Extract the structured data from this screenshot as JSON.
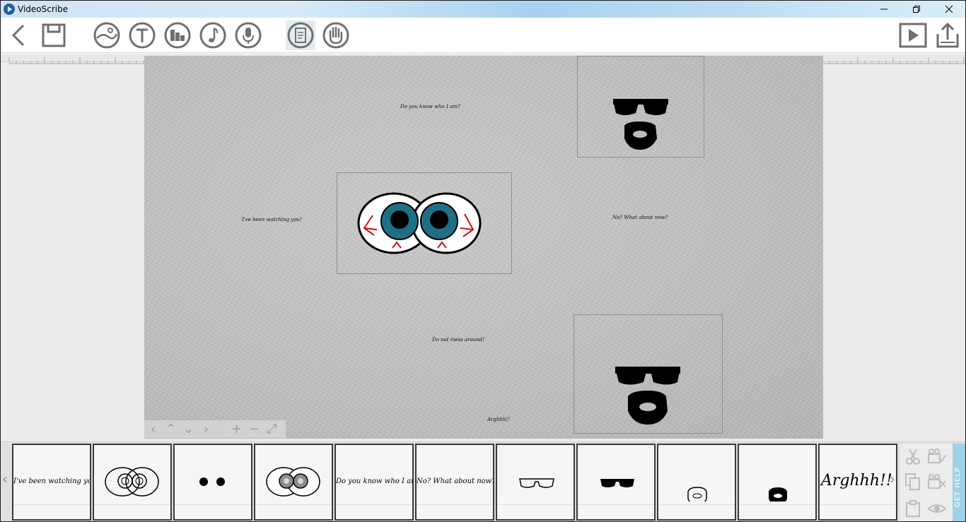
{
  "window": {
    "title": "VideoScribe"
  },
  "canvas_texts": {
    "know": "Do you know who I am?",
    "watching": "I've been watching you!",
    "what_about": "No? What about now?",
    "mess": "Do not mess around!",
    "argh": "Arghhh!!"
  },
  "timeline": {
    "thumbs": [
      {
        "kind": "text",
        "text": "I've been watching you!"
      },
      {
        "kind": "eyes-outline"
      },
      {
        "kind": "dots"
      },
      {
        "kind": "eyes-grey"
      },
      {
        "kind": "text",
        "text": "Do you know who I am?"
      },
      {
        "kind": "text",
        "text": "No? What about now?"
      },
      {
        "kind": "glasses-outline"
      },
      {
        "kind": "glasses-black"
      },
      {
        "kind": "beard-outline"
      },
      {
        "kind": "beard-black"
      },
      {
        "kind": "text-big",
        "text": "Arghhh!!"
      }
    ],
    "get_help": "GET HELP"
  },
  "colors": {
    "iris": "#1f6f87",
    "vein": "#d01010",
    "toolbar_icon": "#6f6f6f",
    "help": "#9fd2e6"
  }
}
